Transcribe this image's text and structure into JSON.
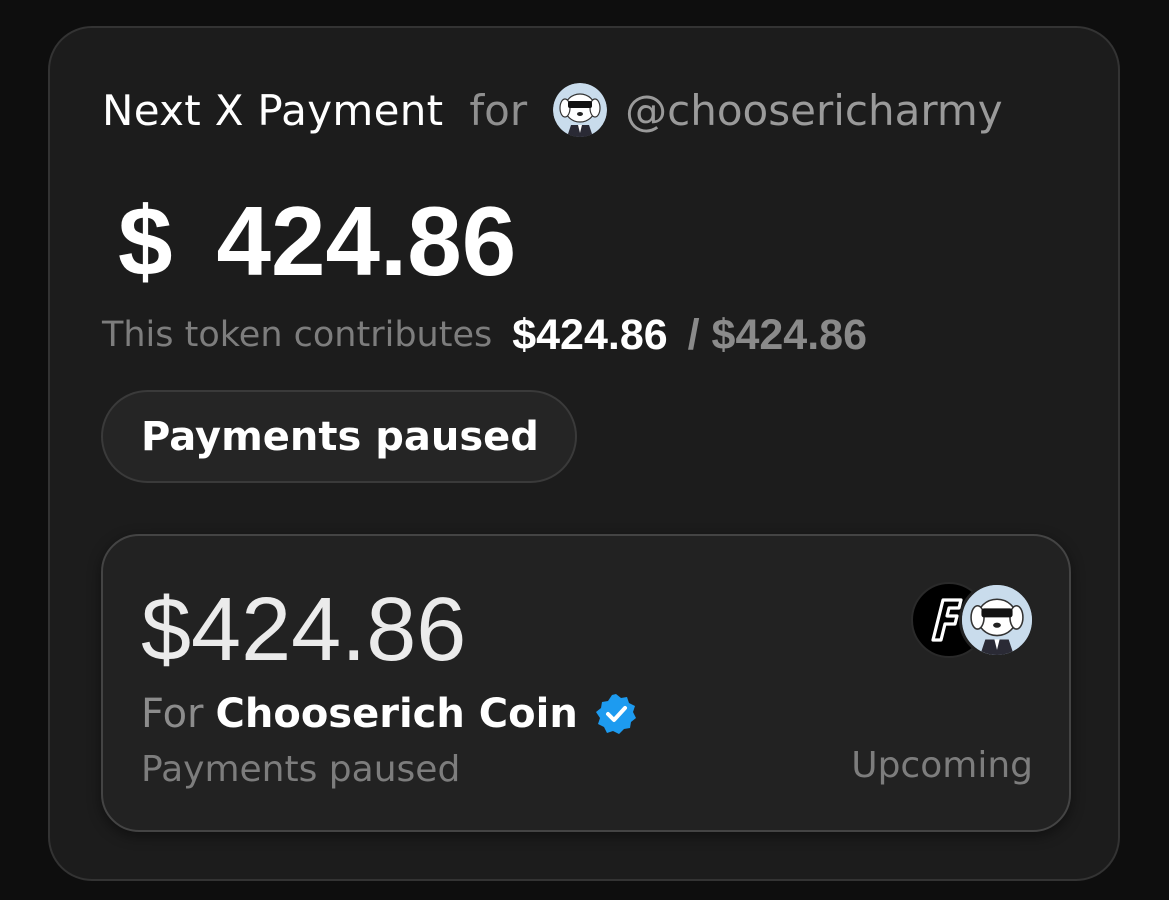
{
  "header": {
    "title": "Next X Payment",
    "for_label": "for",
    "handle": "@choosericharmy"
  },
  "payment": {
    "currency_symbol": "$",
    "amount": "424.86"
  },
  "contribution": {
    "label": "This token contributes",
    "value": "$424.86",
    "total": "/ $424.86"
  },
  "status_pill": {
    "label": "Payments paused"
  },
  "token_card": {
    "amount": "$424.86",
    "for_prefix": "For",
    "coin_name": "Chooserich Coin",
    "status": "Payments paused",
    "schedule": "Upcoming"
  },
  "colors": {
    "background": "#0e0e0e",
    "card": "#1c1c1c",
    "inner_card": "#222222",
    "verified_badge": "#1d9bf0",
    "text_primary": "#ffffff",
    "text_muted": "#7d7d7d"
  },
  "icons": {
    "user_avatar": "dog-with-sunglasses-avatar",
    "token_logo": "f-letter-token-logo",
    "verified": "verified-checkmark-icon"
  }
}
